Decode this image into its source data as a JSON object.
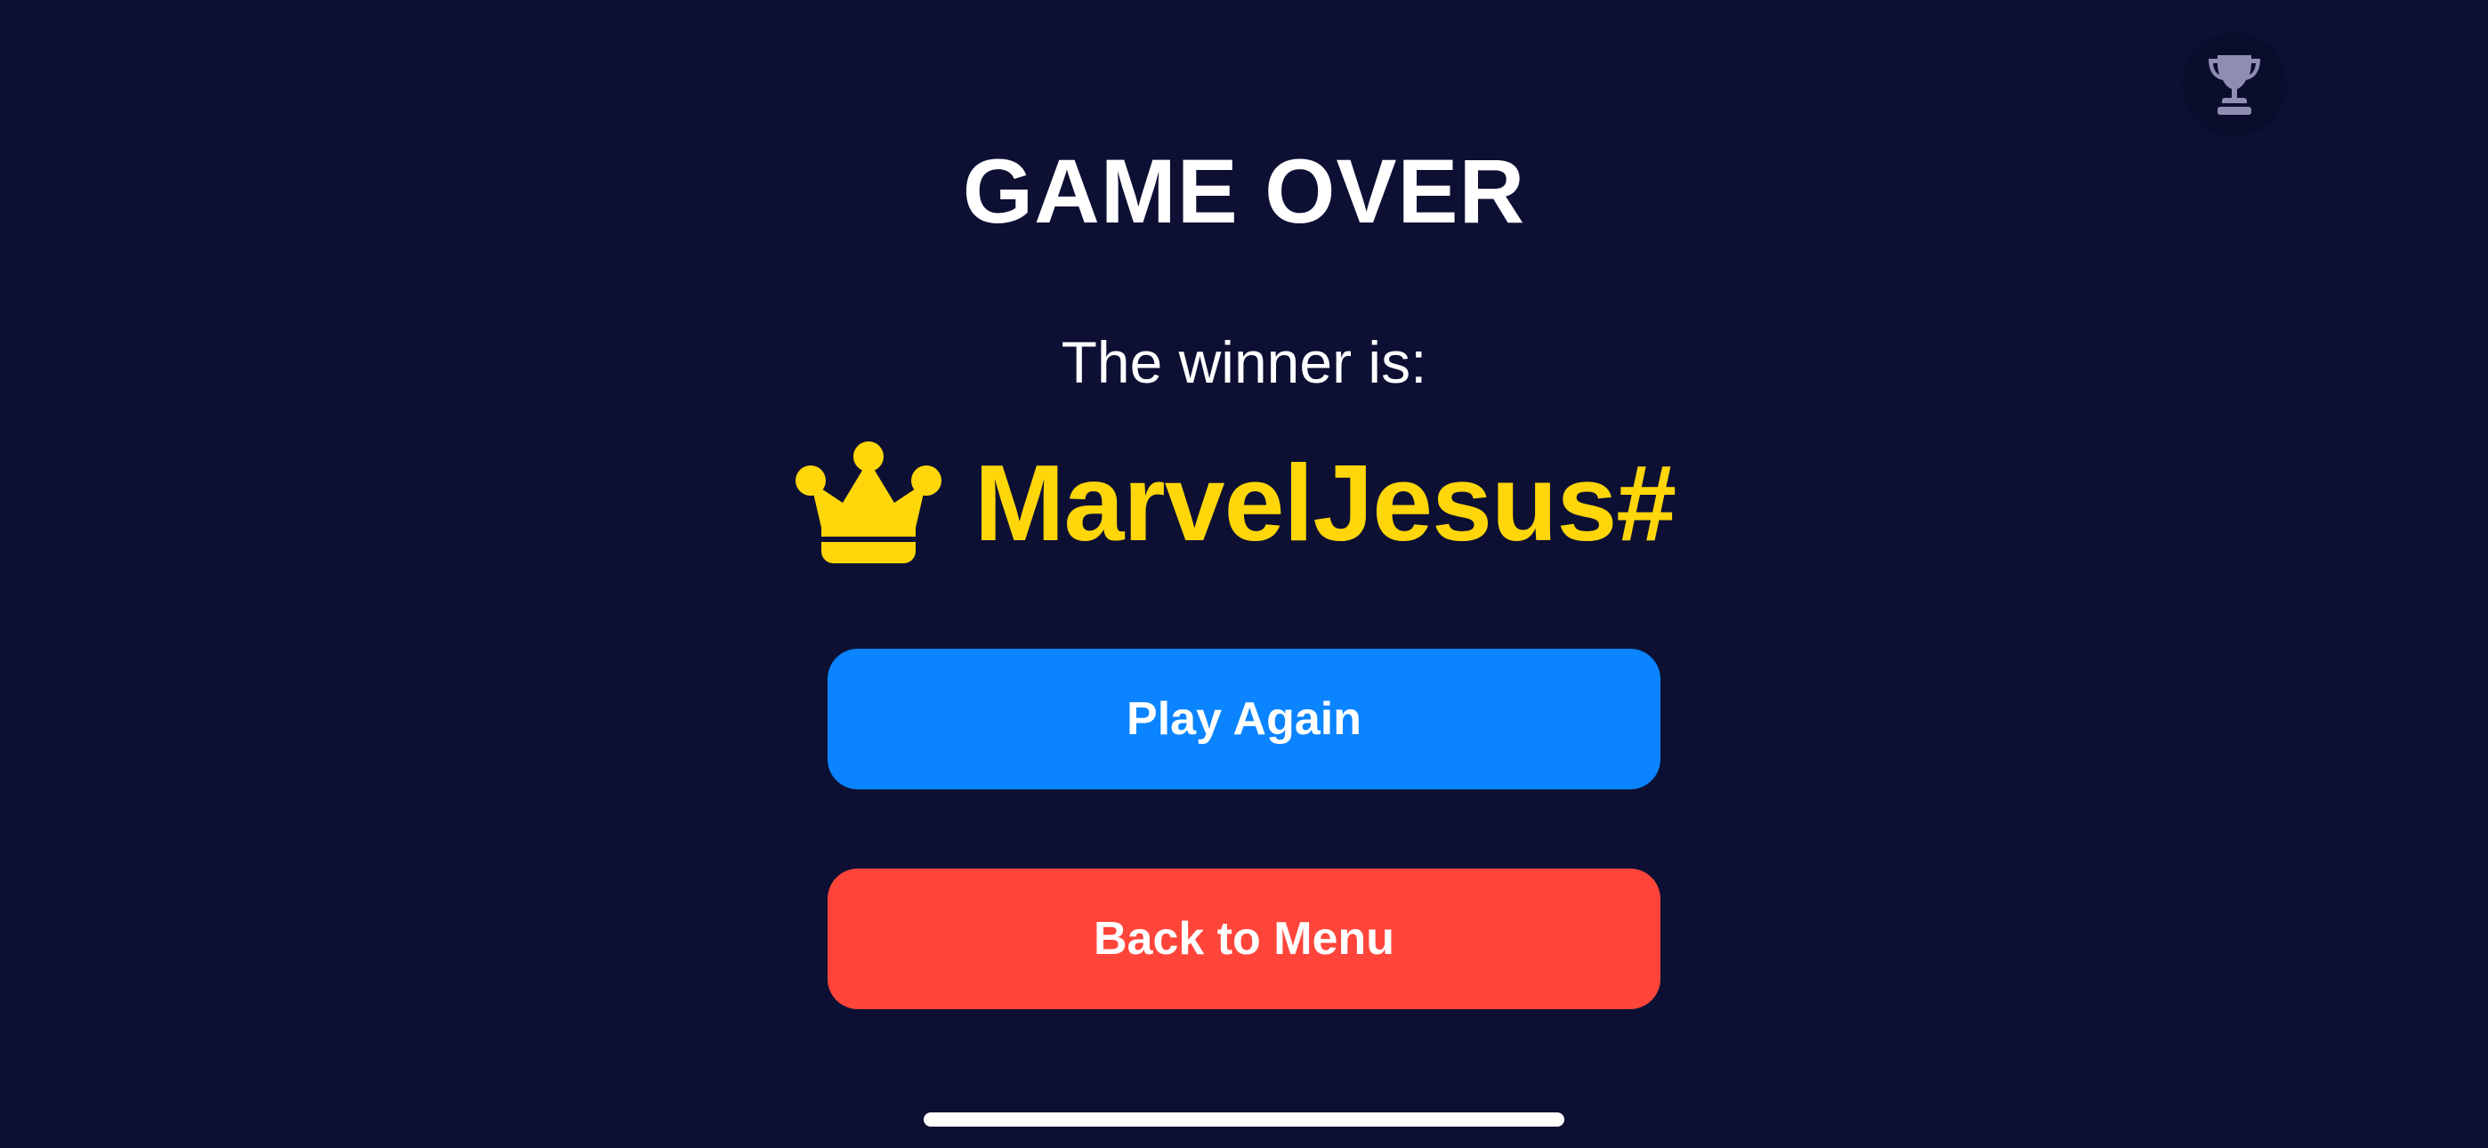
{
  "screen": {
    "background_color": "#0d1033"
  },
  "leaderboard_button": {
    "icon": "trophy-icon",
    "icon_color": "#8e8fb0"
  },
  "game_over": {
    "title": "GAME OVER",
    "subtitle": "The winner is:",
    "winner_icon": "crown-icon",
    "winner_name": "MarvelJesus#",
    "winner_color": "#ffd60a"
  },
  "actions": {
    "play_again_label": "Play Again",
    "play_again_color": "#0a84ff",
    "back_to_menu_label": "Back to Menu",
    "back_to_menu_color": "#ff453a"
  }
}
